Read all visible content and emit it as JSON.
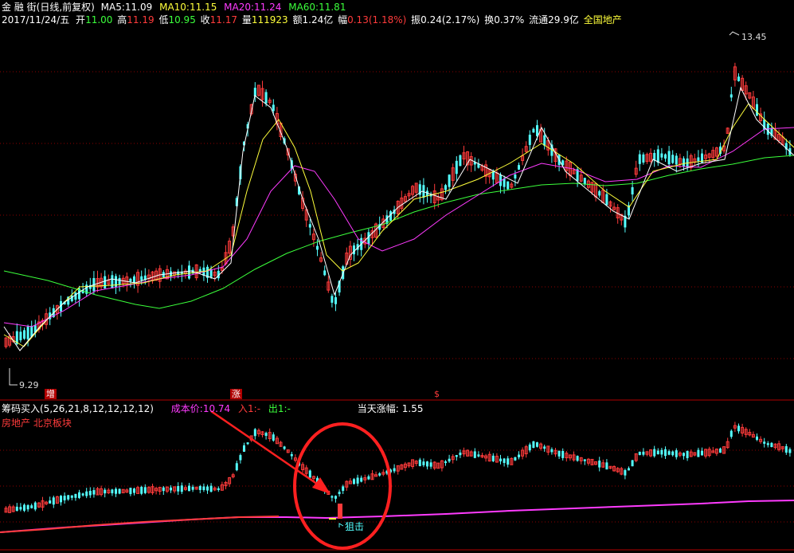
{
  "header": {
    "stock_name": "金 融 街",
    "period_label": "(日线,前复权)",
    "ma5_label": "MA5:",
    "ma5": "11.09",
    "ma10_label": "MA10:",
    "ma10": "11.15",
    "ma20_label": "MA20:",
    "ma20": "11.24",
    "ma60_label": "MA60:",
    "ma60": "11.81",
    "date": "2017/11/24/五",
    "open_label": "开",
    "open": "11.00",
    "high_label": "高",
    "high": "11.19",
    "low_label": "低",
    "low": "10.95",
    "close_label": "收",
    "close": "11.17",
    "volume_label": "量",
    "volume": "111923",
    "amount_label": "额",
    "amount": "1.24亿",
    "change_label": "幅",
    "change": "0.13(1.18%)",
    "amplitude_label": "振",
    "amplitude": "0.24(2.17%)",
    "turnover_label": "换",
    "turnover": "0.37%",
    "float_label": "流通",
    "float": "29.9亿",
    "sector": "全国地产"
  },
  "main_chart": {
    "price_max_label": "13.45",
    "price_min_label": "9.29",
    "marker_zeng": "增",
    "marker_zhang": "涨",
    "marker_s": "$"
  },
  "sub_chart": {
    "indicator": "筹码买入(5,26,21,8,12,12,12,12)",
    "cost_label": "成本价:",
    "cost": "10.74",
    "in_label": "入1:",
    "in_value": "-",
    "out_label": "出1:",
    "out_value": "-",
    "today_range_label": "当天涨幅:",
    "today_range": "1.55",
    "sector_tags": "房地产 北京板块",
    "snipe_label": "狙击"
  },
  "colors": {
    "up": "#ff3b3b",
    "down": "#54ffff",
    "ma5": "#ffffff",
    "ma10": "#ffff3b",
    "ma20": "#ff3bff",
    "ma60": "#3bff3b",
    "cost_line": "#ff3bff",
    "annotation": "#ff2020"
  }
}
